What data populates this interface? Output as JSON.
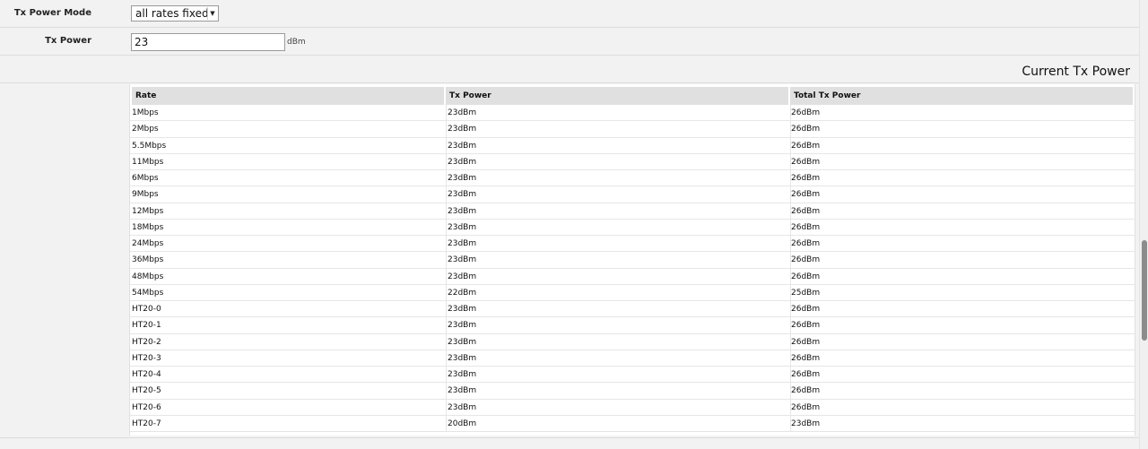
{
  "form": {
    "tx_power_mode": {
      "label": "Tx Power Mode",
      "selected": "all rates fixed"
    },
    "tx_power": {
      "label": "Tx Power",
      "value": "23",
      "unit": "dBm"
    }
  },
  "current_tx_power": {
    "title": "Current Tx Power",
    "columns": [
      "Rate",
      "Tx Power",
      "Total Tx Power"
    ],
    "rows": [
      {
        "rate": "1Mbps",
        "tx": "23dBm",
        "total": "26dBm"
      },
      {
        "rate": "2Mbps",
        "tx": "23dBm",
        "total": "26dBm"
      },
      {
        "rate": "5.5Mbps",
        "tx": "23dBm",
        "total": "26dBm"
      },
      {
        "rate": "11Mbps",
        "tx": "23dBm",
        "total": "26dBm"
      },
      {
        "rate": "6Mbps",
        "tx": "23dBm",
        "total": "26dBm"
      },
      {
        "rate": "9Mbps",
        "tx": "23dBm",
        "total": "26dBm"
      },
      {
        "rate": "12Mbps",
        "tx": "23dBm",
        "total": "26dBm"
      },
      {
        "rate": "18Mbps",
        "tx": "23dBm",
        "total": "26dBm"
      },
      {
        "rate": "24Mbps",
        "tx": "23dBm",
        "total": "26dBm"
      },
      {
        "rate": "36Mbps",
        "tx": "23dBm",
        "total": "26dBm"
      },
      {
        "rate": "48Mbps",
        "tx": "23dBm",
        "total": "26dBm"
      },
      {
        "rate": "54Mbps",
        "tx": "22dBm",
        "total": "25dBm"
      },
      {
        "rate": "HT20-0",
        "tx": "23dBm",
        "total": "26dBm"
      },
      {
        "rate": "HT20-1",
        "tx": "23dBm",
        "total": "26dBm"
      },
      {
        "rate": "HT20-2",
        "tx": "23dBm",
        "total": "26dBm"
      },
      {
        "rate": "HT20-3",
        "tx": "23dBm",
        "total": "26dBm"
      },
      {
        "rate": "HT20-4",
        "tx": "23dBm",
        "total": "26dBm"
      },
      {
        "rate": "HT20-5",
        "tx": "23dBm",
        "total": "26dBm"
      },
      {
        "rate": "HT20-6",
        "tx": "23dBm",
        "total": "26dBm"
      },
      {
        "rate": "HT20-7",
        "tx": "20dBm",
        "total": "23dBm"
      }
    ]
  },
  "icons": {
    "select_arrow": "chevron-down-icon"
  },
  "colors": {
    "page_background": "#f2f2f2",
    "table_background": "#ffffff",
    "header_background": "#e0e0e0",
    "divider": "#dcdcdc",
    "scroll_thumb": "#8c8c8c"
  }
}
